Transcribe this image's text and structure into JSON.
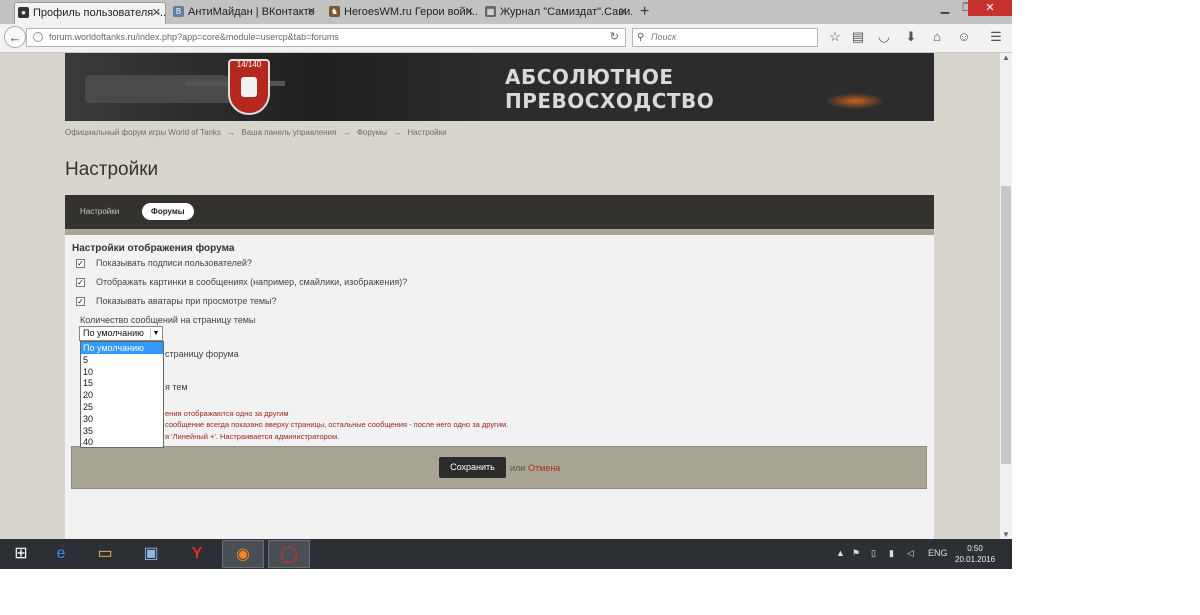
{
  "browser": {
    "tabs": [
      {
        "label": "Профиль пользователя -...",
        "active": true
      },
      {
        "label": "АнтиМайдан | ВКонтакте",
        "active": false
      },
      {
        "label": "HeroesWM.ru Герои войн...",
        "active": false
      },
      {
        "label": "Журнал \"Самиздат\".Сави...",
        "active": false
      }
    ],
    "url": "forum.worldoftanks.ru/index.php?app=core&module=usercp&tab=forums",
    "search_placeholder": "Поиск"
  },
  "banner": {
    "shield_label": "14/140",
    "tagline_line1": "АБСОЛЮТНОЕ",
    "tagline_line2": "ПРЕВОСХОДСТВО"
  },
  "breadcrumb": [
    "Официальный форум игры World of Tanks",
    "→",
    "Ваша панель управления",
    "→",
    "Форумы",
    "→",
    "Настройки"
  ],
  "page": {
    "title": "Настройки",
    "tabs": [
      {
        "label": "Настройки",
        "active": false
      },
      {
        "label": "Форумы",
        "active": true
      }
    ]
  },
  "forum_display": {
    "section_title": "Настройки отображения форума",
    "checkboxes": [
      {
        "label": "Показывать подписи пользователей?",
        "checked": true
      },
      {
        "label": "Отображать картинки в сообщениях (например, смайлики, изображения)?",
        "checked": true
      },
      {
        "label": "Показывать аватары при просмотре темы?",
        "checked": true
      }
    ],
    "posts_per_topic_label": "Количество сообщений на страницу темы",
    "posts_per_topic_selected": "По умолчанию",
    "posts_per_topic_options": [
      "По умолчанию",
      "5",
      "10",
      "15",
      "20",
      "25",
      "30",
      "35",
      "40"
    ],
    "topics_per_forum_partial": "страницу форума",
    "topics_view_partial": "я тем",
    "note_line1": "ения отображаются одно за другим",
    "note_line2": "сообщение всегда показано вверху страницы, остальные сообщения - после него одно за другим.",
    "note_line3": "я 'Линейный +'. Настраивается администратором."
  },
  "actions": {
    "save": "Сохранить",
    "or": "или",
    "cancel": "Отмена"
  },
  "taskbar": {
    "lang": "ENG",
    "time": "0:50",
    "date": "20.01.2016"
  }
}
